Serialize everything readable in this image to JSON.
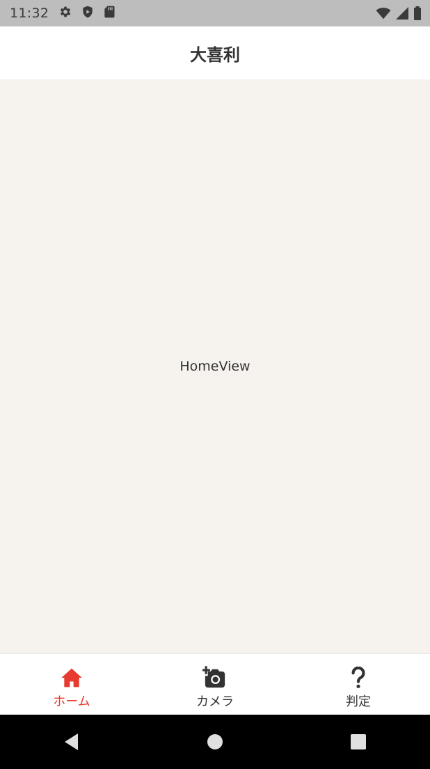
{
  "status_bar": {
    "time": "11:32",
    "left_icons": [
      "settings-gear-icon",
      "play-protect-icon",
      "sd-card-icon"
    ],
    "right_icons": [
      "wifi-icon",
      "cell-signal-icon",
      "battery-icon"
    ]
  },
  "app_bar": {
    "title": "大喜利"
  },
  "content": {
    "label": "HomeView"
  },
  "bottom_nav": {
    "items": [
      {
        "label": "ホーム",
        "icon": "home-icon",
        "active": true
      },
      {
        "label": "カメラ",
        "icon": "add-camera-icon",
        "active": false
      },
      {
        "label": "判定",
        "icon": "question-mark-icon",
        "active": false
      }
    ]
  },
  "system_nav": {
    "buttons": [
      "back-icon",
      "home-circle-icon",
      "recents-icon"
    ]
  },
  "colors": {
    "accent": "#e63b2e",
    "status_bar": "#bdbdbd",
    "content_bg": "#f6f3ee",
    "text": "#333333"
  }
}
